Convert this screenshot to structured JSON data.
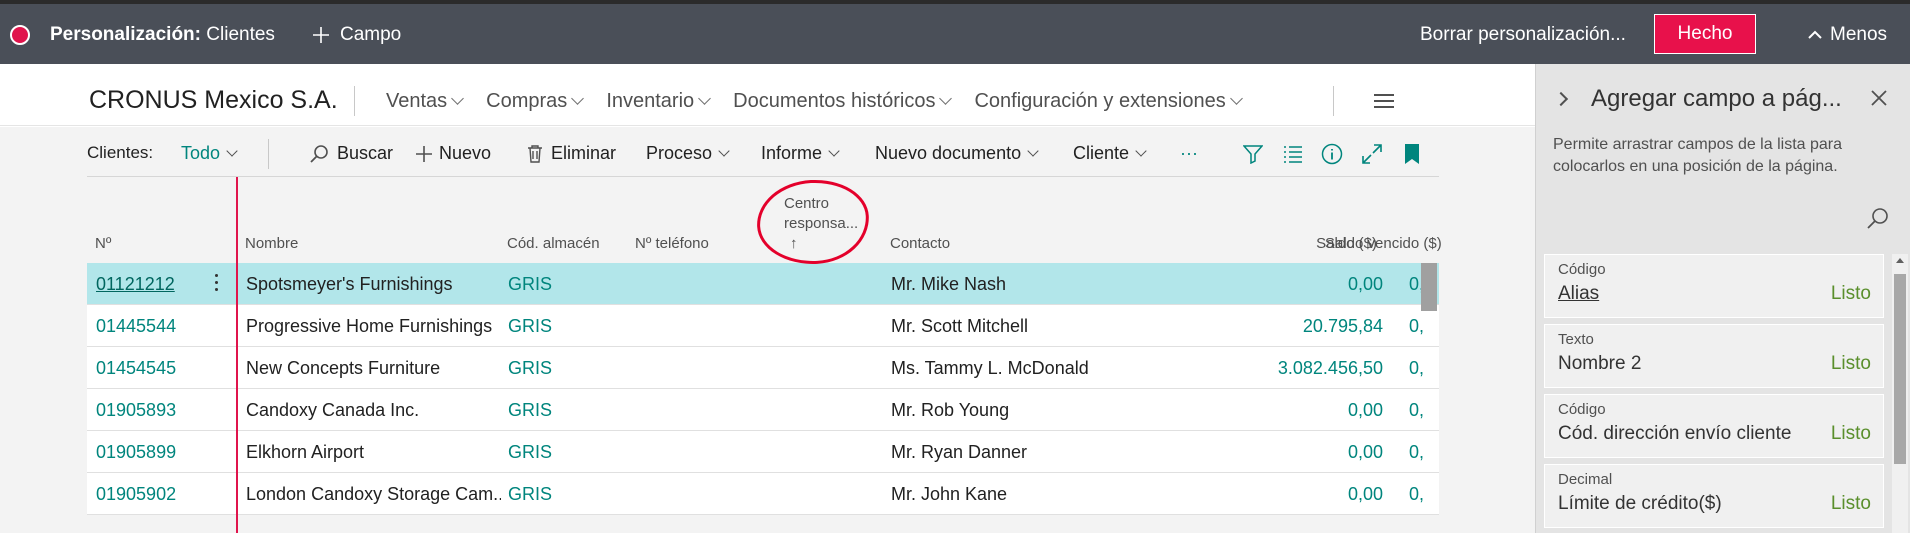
{
  "personalization": {
    "title_bold": "Personalización:",
    "title_rest": " Clientes",
    "add_field": "Campo",
    "reset": "Borrar personalización...",
    "done": "Hecho",
    "less": "Menos"
  },
  "nav": {
    "company": "CRONUS Mexico S.A.",
    "items": [
      "Ventas",
      "Compras",
      "Inventario",
      "Documentos históricos",
      "Configuración y extensiones"
    ]
  },
  "actions": {
    "page_label": "Clientes:",
    "filter_view": "Todo",
    "search": "Buscar",
    "new": "Nuevo",
    "delete": "Eliminar",
    "process": "Proceso",
    "report": "Informe",
    "new_document": "Nuevo documento",
    "customer": "Cliente",
    "more": "···"
  },
  "table": {
    "headers": {
      "no": "Nº",
      "name": "Nombre",
      "location": "Cód. almacén",
      "phone": "Nº teléfono",
      "resp_center_1": "Centro",
      "resp_center_2": "responsa...",
      "resp_center_arrow": "↑",
      "contact": "Contacto",
      "balance": "Saldo ($)",
      "overdue": "Saldo vencido ($)"
    },
    "rows": [
      {
        "no": "01121212",
        "name": "Spotsmeyer's Furnishings",
        "location": "GRIS",
        "contact": "Mr. Mike Nash",
        "balance": "0,00",
        "overdue": "0,"
      },
      {
        "no": "01445544",
        "name": "Progressive Home Furnishings",
        "location": "GRIS",
        "contact": "Mr. Scott Mitchell",
        "balance": "20.795,84",
        "overdue": "0,"
      },
      {
        "no": "01454545",
        "name": "New Concepts Furniture",
        "location": "GRIS",
        "contact": "Ms. Tammy L. McDonald",
        "balance": "3.082.456,50",
        "overdue": "0,"
      },
      {
        "no": "01905893",
        "name": "Candoxy Canada Inc.",
        "location": "GRIS",
        "contact": "Mr. Rob Young",
        "balance": "0,00",
        "overdue": "0,"
      },
      {
        "no": "01905899",
        "name": "Elkhorn Airport",
        "location": "GRIS",
        "contact": "Mr. Ryan Danner",
        "balance": "0,00",
        "overdue": "0,"
      },
      {
        "no": "01905902",
        "name": "London Candoxy Storage Cam...",
        "location": "GRIS",
        "contact": "Mr. John Kane",
        "balance": "0,00",
        "overdue": "0,"
      }
    ]
  },
  "pane": {
    "title": "Agregar campo a pág...",
    "description": "Permite arrastrar campos de la lista para colocarlos en una posición de la página.",
    "fields": [
      {
        "type": "Código",
        "name": "Alias",
        "status": "Listo"
      },
      {
        "type": "Texto",
        "name": "Nombre 2",
        "status": "Listo"
      },
      {
        "type": "Código",
        "name": "Cód. dirección envío cliente",
        "status": "Listo"
      },
      {
        "type": "Decimal",
        "name": "Límite de crédito($)",
        "status": "Listo"
      }
    ]
  },
  "colors": {
    "accent": "#e8114b",
    "link": "#00857d",
    "selected_row": "#b2e6ea",
    "status_ready": "#5a8f2c",
    "annotation": "#e4002b"
  }
}
